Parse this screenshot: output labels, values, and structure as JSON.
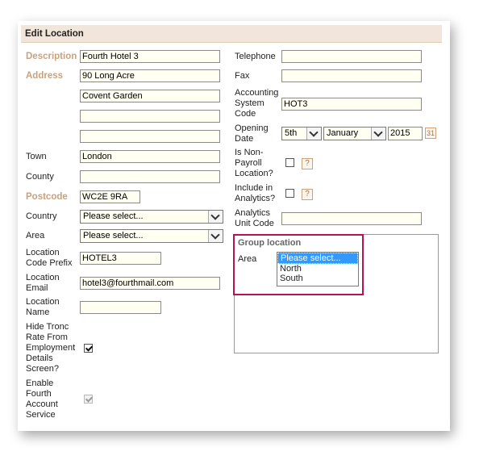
{
  "panel": {
    "title": "Edit Location"
  },
  "left": {
    "description_label": "Description",
    "description_value": "Fourth Hotel 3",
    "address_label": "Address",
    "address_line1": "90 Long Acre",
    "address_line2": "Covent Garden",
    "address_line3": "",
    "address_line4": "",
    "town_label": "Town",
    "town_value": "London",
    "county_label": "County",
    "county_value": "",
    "postcode_label": "Postcode",
    "postcode_value": "WC2E 9RA",
    "country_label": "Country",
    "country_value": "Please select...",
    "area_label": "Area",
    "area_value": "Please select...",
    "prefix_label_1": "Location",
    "prefix_label_2": "Code Prefix",
    "prefix_value": "HOTEL3",
    "email_label_1": "Location",
    "email_label_2": "Email",
    "email_value": "hotel3@fourthmail.com",
    "name_label_1": "Location",
    "name_label_2": "Name",
    "name_value": "",
    "tronc_label_1": "Hide Tronc",
    "tronc_label_2": "Rate From",
    "tronc_label_3": "Employment",
    "tronc_label_4": "Details",
    "tronc_label_5": "Screen?",
    "tronc_checked": true,
    "fas_label_1": "Enable",
    "fas_label_2": "Fourth",
    "fas_label_3": "Account",
    "fas_label_4": "Service",
    "fas_checked": true
  },
  "right": {
    "telephone_label": "Telephone",
    "telephone_value": "",
    "fax_label": "Fax",
    "fax_value": "",
    "acs_label_1": "Accounting",
    "acs_label_2": "System",
    "acs_label_3": "Code",
    "acs_value": "HOT3",
    "opening_label_1": "Opening",
    "opening_label_2": "Date",
    "opening_day": "5th",
    "opening_month": "January",
    "opening_year": "2015",
    "calendar_glyph": "31",
    "nonpayroll_label_1": "Is Non-",
    "nonpayroll_label_2": "Payroll",
    "nonpayroll_label_3": "Location?",
    "analytics_label_1": "Include in",
    "analytics_label_2": "Analytics?",
    "help_glyph": "?",
    "unitcode_label_1": "Analytics",
    "unitcode_label_2": "Unit Code",
    "unitcode_value": ""
  },
  "group": {
    "title": "Group location",
    "area_label": "Area",
    "options": [
      "Please select...",
      "North",
      "South"
    ],
    "highlight_color": "#b5125c"
  }
}
